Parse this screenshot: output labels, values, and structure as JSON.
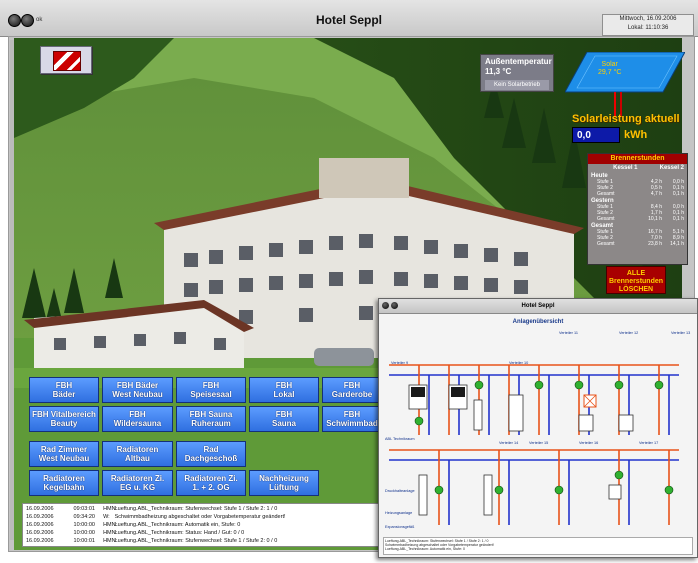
{
  "window": {
    "title": "Hotel Seppl",
    "ok_label": "ok",
    "date_line1": "Mittwoch, 16.09.2006",
    "date_line2": "Lokal: 11:10:36"
  },
  "weather": {
    "title": "Außentemperatur",
    "temperature": "11,3 °C",
    "solar_status": "Kein Solarbetrieb"
  },
  "solar": {
    "panel_label": "Solar",
    "panel_temp": "29,7 °C",
    "title": "Solarleistung aktuell",
    "value": "0,0",
    "unit": "kWh"
  },
  "burner_hours": {
    "title": "Brennerstunden",
    "col1": "Kessel 1",
    "col2": "Kessel 2",
    "sections": [
      {
        "label": "Heute",
        "rows": [
          {
            "name": "Stufe 1",
            "k1": "4,2 h",
            "k2": "0,0 h"
          },
          {
            "name": "Stufe 2",
            "k1": "0,5 h",
            "k2": "0,1 h"
          },
          {
            "name": "Gesamt",
            "k1": "4,7 h",
            "k2": "0,1 h"
          }
        ]
      },
      {
        "label": "Gestern",
        "rows": [
          {
            "name": "Stufe 1",
            "k1": "8,4 h",
            "k2": "0,0 h"
          },
          {
            "name": "Stufe 2",
            "k1": "1,7 h",
            "k2": "0,1 h"
          },
          {
            "name": "Gesamt",
            "k1": "10,1 h",
            "k2": "0,1 h"
          }
        ]
      },
      {
        "label": "Gesamt",
        "rows": [
          {
            "name": "Stufe 1",
            "k1": "16,7 h",
            "k2": "5,1 h"
          },
          {
            "name": "Stufe 2",
            "k1": "7,0 h",
            "k2": "8,9 h"
          },
          {
            "name": "Gesamt",
            "k1": "23,8 h",
            "k2": "14,1 h"
          }
        ]
      }
    ],
    "reset_label_1": "ALLE",
    "reset_label_2": "Brennerstunden",
    "reset_label_3": "LÖSCHEN"
  },
  "buttons": [
    {
      "l1": "FBH",
      "l2": "Bäder"
    },
    {
      "l1": "FBH Bäder",
      "l2": "West Neubau"
    },
    {
      "l1": "FBH",
      "l2": "Speisesaal"
    },
    {
      "l1": "FBH",
      "l2": "Lokal"
    },
    {
      "l1": "FBH",
      "l2": "Garderobe"
    },
    {
      "l1": "FBH Vitalbereich",
      "l2": "Beauty"
    },
    {
      "l1": "FBH",
      "l2": "Wildersauna"
    },
    {
      "l1": "FBH Sauna",
      "l2": "Ruheraum"
    },
    {
      "l1": "FBH",
      "l2": "Sauna"
    },
    {
      "l1": "FBH",
      "l2": "Schwimmbad"
    },
    {
      "l1": "Rad Zimmer",
      "l2": "West Neubau"
    },
    {
      "l1": "Radiatoren",
      "l2": "Altbau"
    },
    {
      "l1": "Rad",
      "l2": "Dachgeschoß"
    },
    {
      "l1": "Radiatoren",
      "l2": "Kegelbahn"
    },
    {
      "l1": "Radiatoren Zi.",
      "l2": "EG u. KG"
    },
    {
      "l1": "Radiatoren Zi.",
      "l2": "1. + 2. OG"
    },
    {
      "l1": "Nachheizung",
      "l2": "Lüftung"
    }
  ],
  "log": [
    {
      "date": "16.09.2006",
      "time": "09:03:01",
      "src": "HMN:",
      "text": "Lueftung.ABL_Technikraum: Stufenwechsel: Stufe 1 / Stufe 2: 1 / 0"
    },
    {
      "date": "16.09.2006",
      "time": "09:34:20",
      "src": "W:",
      "text": "Schwimmbadheizung abgeschaltet oder Vorgabetemperatur geändert!"
    },
    {
      "date": "16.09.2006",
      "time": "10:00:00",
      "src": "HMN:",
      "text": "Lueftung.ABL_Technikraum: Automatik ein, Stufe: 0"
    },
    {
      "date": "16.09.2006",
      "time": "10:00:00",
      "src": "HMN:",
      "text": "Lueftung.ABL_Technikraum: Status: Hand / Gut: 0 / 0"
    },
    {
      "date": "16.09.2006",
      "time": "10:00:01",
      "src": "HMN:",
      "text": "Lueftung.ABL_Technikraum: Stufenwechsel: Stufe 1 / Stufe 2: 0 / 0"
    }
  ],
  "inset": {
    "title": "Hotel Seppl",
    "subtitle": "Anlagenübersicht",
    "labels": [
      "Verteiler 9",
      "Verteiler 10",
      "Verteiler 11",
      "Verteiler 12",
      "Verteiler 13",
      "Verteiler 14",
      "Verteiler 15",
      "Verteiler 16",
      "Verteiler 17",
      "ABL Technikraum",
      "Druckhalteanlage",
      "Heizungsanlage",
      "Expansionsgefäß"
    ]
  },
  "colors": {
    "button_blue": "#3f82f0",
    "burner_red": "#a00000",
    "solar_yellow": "#ffc000",
    "kwh_blue": "#0d1aa8"
  }
}
